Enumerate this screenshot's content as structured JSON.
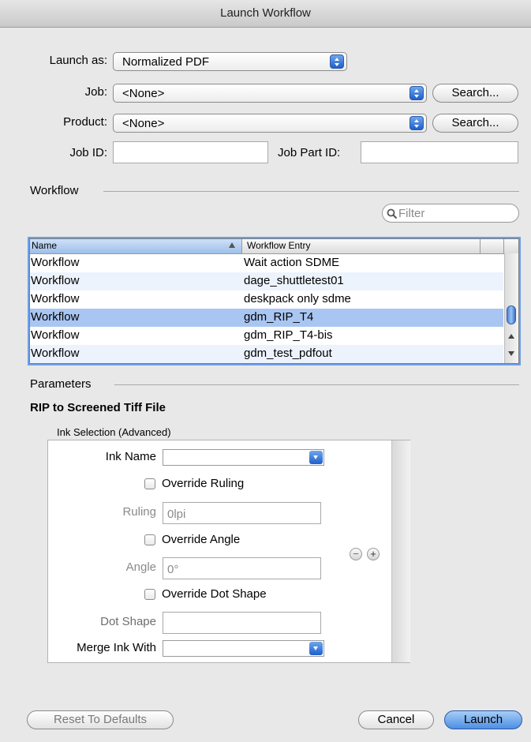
{
  "window": {
    "title": "Launch Workflow"
  },
  "launch_as": {
    "label": "Launch as:",
    "value": "Normalized PDF"
  },
  "job": {
    "label": "Job:",
    "value": "<None>",
    "search_label": "Search..."
  },
  "product": {
    "label": "Product:",
    "value": "<None>",
    "search_label": "Search..."
  },
  "job_id": {
    "label": "Job ID:",
    "value": ""
  },
  "job_part_id": {
    "label": "Job Part ID:",
    "value": ""
  },
  "workflow": {
    "section_label": "Workflow",
    "filter_placeholder": "Filter",
    "columns": [
      "Name",
      "Workflow Entry"
    ],
    "rows": [
      {
        "name": "Workflow",
        "entry": "Wait action SDME"
      },
      {
        "name": "Workflow",
        "entry": "dage_shuttletest01"
      },
      {
        "name": "Workflow",
        "entry": "deskpack only sdme"
      },
      {
        "name": "Workflow",
        "entry": "gdm_RIP_T4"
      },
      {
        "name": "Workflow",
        "entry": "gdm_RIP_T4-bis"
      },
      {
        "name": "Workflow",
        "entry": "gdm_test_pdfout"
      }
    ],
    "selected_row": 3
  },
  "parameters": {
    "section_label": "Parameters",
    "heading": "RIP to Screened Tiff File",
    "ink_group_label": "Ink Selection (Advanced)",
    "ink_name_label": "Ink Name",
    "ink_name_value": "",
    "override_ruling_label": "Override Ruling",
    "ruling_label": "Ruling",
    "ruling_value": "0lpi",
    "override_angle_label": "Override Angle",
    "angle_label": "Angle",
    "angle_value": "0°",
    "override_dot_shape_label": "Override Dot Shape",
    "dot_shape_label": "Dot Shape",
    "dot_shape_value": "",
    "merge_ink_label": "Merge Ink With",
    "merge_ink_value": "",
    "remove_symbol": "−",
    "add_symbol": "+"
  },
  "buttons": {
    "reset": "Reset To Defaults",
    "cancel": "Cancel",
    "launch": "Launch"
  },
  "colors": {
    "accent": "#3a7be0",
    "selection": "#a9c6f2",
    "alt_row": "#edf3fd"
  }
}
